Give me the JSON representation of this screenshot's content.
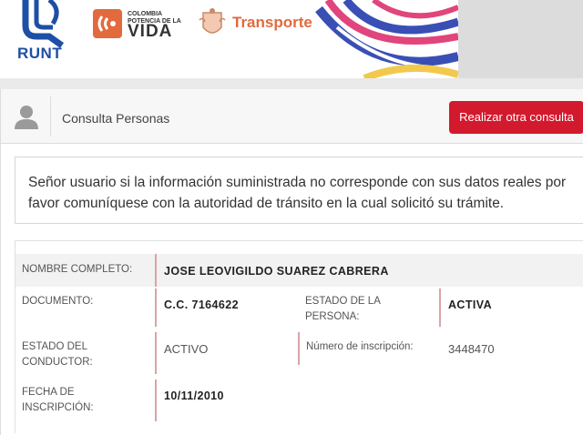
{
  "header": {
    "runt_label": "RUNT",
    "colombia_small": "COLOMBIA\nPOTENCIA DE LA",
    "colombia_vida": "VIDA",
    "transporte_label": "Transporte"
  },
  "panel": {
    "title": "Consulta Personas",
    "button_label": "Realizar otra consulta"
  },
  "notice": {
    "text": "Señor usuario si la información suministrada no corresponde con sus datos reales por favor comuníquese con la autoridad de tránsito en la cual solicitó su trámite."
  },
  "person": {
    "nombre_label": "NOMBRE COMPLETO:",
    "nombre_value": "JOSE LEOVIGILDO SUAREZ CABRERA",
    "documento_label": "DOCUMENTO:",
    "documento_value": "C.C. 7164622",
    "estado_persona_label": "ESTADO DE LA PERSONA:",
    "estado_persona_value": "ACTIVA",
    "estado_conductor_label": "ESTADO DEL CONDUCTOR:",
    "estado_conductor_value": "ACTIVO",
    "inscripcion_num_label": "Número de inscripción:",
    "inscripcion_num_value": "3448470",
    "fecha_label": "FECHA DE INSCRIPCIÓN:",
    "fecha_value": "10/11/2010"
  },
  "colors": {
    "accent_red": "#d3192d",
    "runt_blue": "#1d4fa5",
    "transporte_orange": "#e26a3c"
  }
}
